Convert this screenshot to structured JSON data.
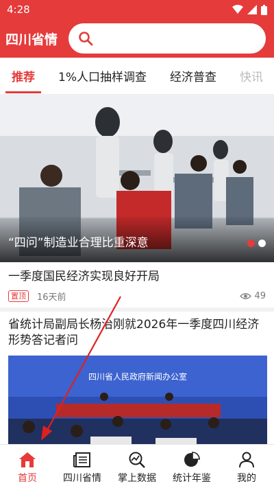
{
  "status": {
    "time": "4:28"
  },
  "header": {
    "brand": "四川省情",
    "search_placeholder": ""
  },
  "tabs": [
    {
      "label": "推荐",
      "active": true
    },
    {
      "label": "1%人口抽样调查",
      "active": false
    },
    {
      "label": "经济普查",
      "active": false
    },
    {
      "label": "快讯",
      "active": false
    }
  ],
  "banner": {
    "caption": "“四问”制造业合理比重深意",
    "active_dot": 0,
    "dot_count": 2
  },
  "news": [
    {
      "title": "一季度国民经济实现良好开局",
      "tag": "置顶",
      "time": "16天前",
      "views": "49"
    },
    {
      "title": "省统计局副局长杨治刚就2026年一季度四川经济形势答记者问",
      "image_banner": "四川省人民政府新闻办公室"
    }
  ],
  "navbar": [
    {
      "label": "首页",
      "icon": "home-icon",
      "active": true
    },
    {
      "label": "四川省情",
      "icon": "newspaper-icon",
      "active": false
    },
    {
      "label": "掌上数据",
      "icon": "search-chart-icon",
      "active": false
    },
    {
      "label": "统计年鉴",
      "icon": "pie-chart-icon",
      "active": false
    },
    {
      "label": "我的",
      "icon": "person-icon",
      "active": false
    }
  ],
  "colors": {
    "brand_red": "#e53b3b",
    "page_bg": "#ffffff"
  }
}
